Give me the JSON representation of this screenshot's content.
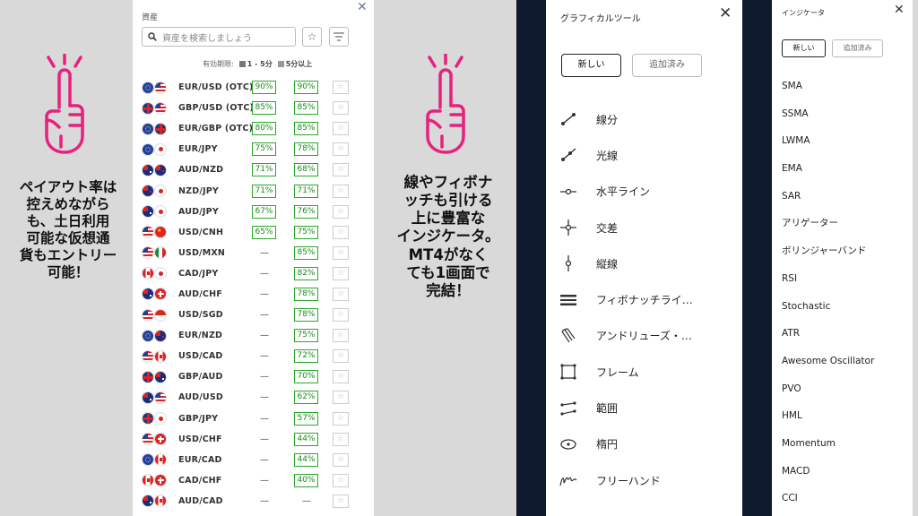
{
  "callouts": {
    "left": [
      "ペイアウト率は",
      "控えめながら",
      "も、土日利用",
      "可能な仮想通",
      "貨もエントリー",
      "可能！"
    ],
    "middle": [
      "線やフィボナ",
      "ッチも引ける",
      "上に豊富な",
      "インジケータ。",
      "MT4がなく",
      "ても1画面で",
      "完結！"
    ]
  },
  "colors": {
    "accent": "#e6217e",
    "payout_green": "#29a829",
    "dark_bg": "#0f1a2e"
  },
  "assets": {
    "title": "資産",
    "search_placeholder": "資産を検索しましょう",
    "legend_label": "有効期限:",
    "legend_a": "1 - 5分",
    "legend_b": "5分以上",
    "rows": [
      {
        "pair": "EUR/USD (OTC)",
        "f1": "eu",
        "f2": "us",
        "p1": "90%",
        "p2": "90%"
      },
      {
        "pair": "GBP/USD (OTC)",
        "f1": "gb",
        "f2": "us",
        "p1": "85%",
        "p2": "85%"
      },
      {
        "pair": "EUR/GBP (OTC)",
        "f1": "eu",
        "f2": "gb",
        "p1": "80%",
        "p2": "85%"
      },
      {
        "pair": "EUR/JPY",
        "f1": "eu",
        "f2": "jp",
        "p1": "75%",
        "p2": "78%"
      },
      {
        "pair": "AUD/NZD",
        "f1": "au",
        "f2": "nz",
        "p1": "71%",
        "p2": "68%"
      },
      {
        "pair": "NZD/JPY",
        "f1": "nz",
        "f2": "jp",
        "p1": "71%",
        "p2": "71%"
      },
      {
        "pair": "AUD/JPY",
        "f1": "au",
        "f2": "jp",
        "p1": "67%",
        "p2": "76%"
      },
      {
        "pair": "USD/CNH",
        "f1": "us",
        "f2": "cn",
        "p1": "65%",
        "p2": "75%"
      },
      {
        "pair": "USD/MXN",
        "f1": "us",
        "f2": "mx",
        "p1": "—",
        "p2": "85%"
      },
      {
        "pair": "CAD/JPY",
        "f1": "ca",
        "f2": "jp",
        "p1": "—",
        "p2": "82%"
      },
      {
        "pair": "AUD/CHF",
        "f1": "au",
        "f2": "ch",
        "p1": "—",
        "p2": "78%"
      },
      {
        "pair": "USD/SGD",
        "f1": "us",
        "f2": "sg",
        "p1": "—",
        "p2": "78%"
      },
      {
        "pair": "EUR/NZD",
        "f1": "eu",
        "f2": "nz",
        "p1": "—",
        "p2": "75%"
      },
      {
        "pair": "USD/CAD",
        "f1": "us",
        "f2": "ca",
        "p1": "—",
        "p2": "72%"
      },
      {
        "pair": "GBP/AUD",
        "f1": "gb",
        "f2": "au",
        "p1": "—",
        "p2": "70%"
      },
      {
        "pair": "AUD/USD",
        "f1": "au",
        "f2": "us",
        "p1": "—",
        "p2": "62%"
      },
      {
        "pair": "GBP/JPY",
        "f1": "gb",
        "f2": "jp",
        "p1": "—",
        "p2": "57%"
      },
      {
        "pair": "USD/CHF",
        "f1": "us",
        "f2": "ch",
        "p1": "—",
        "p2": "44%"
      },
      {
        "pair": "EUR/CAD",
        "f1": "eu",
        "f2": "ca",
        "p1": "—",
        "p2": "44%"
      },
      {
        "pair": "CAD/CHF",
        "f1": "ca",
        "f2": "ch",
        "p1": "—",
        "p2": "40%"
      },
      {
        "pair": "AUD/CAD",
        "f1": "au",
        "f2": "ca",
        "p1": "—",
        "p2": ""
      }
    ]
  },
  "graphic_tools": {
    "title": "グラフィカルツール",
    "tab_new": "新しい",
    "tab_added": "追加済み",
    "items": [
      {
        "label": "線分",
        "icon": "segment-icon"
      },
      {
        "label": "光線",
        "icon": "ray-icon"
      },
      {
        "label": "水平ライン",
        "icon": "horizontal-line-icon"
      },
      {
        "label": "交差",
        "icon": "crosshair-icon"
      },
      {
        "label": "縦線",
        "icon": "vertical-line-icon"
      },
      {
        "label": "フィボナッチライ…",
        "icon": "fibonacci-icon"
      },
      {
        "label": "アンドリューズ・…",
        "icon": "pitchfork-icon"
      },
      {
        "label": "フレーム",
        "icon": "frame-icon"
      },
      {
        "label": "範囲",
        "icon": "range-icon"
      },
      {
        "label": "楕円",
        "icon": "ellipse-icon"
      },
      {
        "label": "フリーハンド",
        "icon": "freehand-icon"
      }
    ]
  },
  "indicators": {
    "title": "インジケータ",
    "tab_new": "新しい",
    "tab_added": "追加済み",
    "items": [
      "SMA",
      "SSMA",
      "LWMA",
      "EMA",
      "SAR",
      "アリゲーター",
      "ボリンジャーバンド",
      "RSI",
      "Stochastic",
      "ATR",
      "Awesome Oscillator",
      "PVO",
      "HML",
      "Momentum",
      "MACD",
      "CCI"
    ]
  }
}
